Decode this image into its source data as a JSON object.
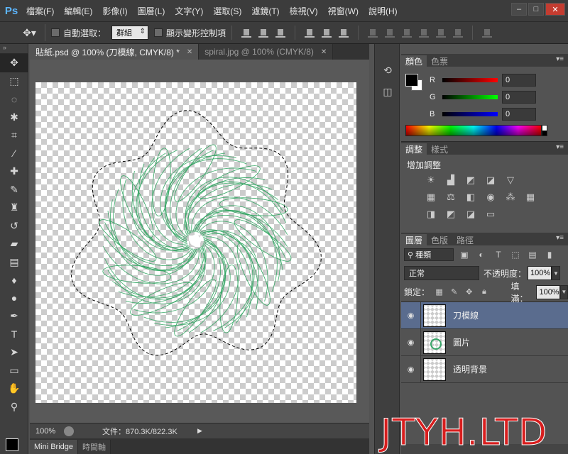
{
  "menu": {
    "logo": "Ps",
    "items": [
      "檔案(F)",
      "編輯(E)",
      "影像(I)",
      "圖層(L)",
      "文字(Y)",
      "選取(S)",
      "濾鏡(T)",
      "檢視(V)",
      "視窗(W)",
      "說明(H)"
    ],
    "window_controls": [
      "–",
      "□",
      "✕"
    ]
  },
  "options": {
    "auto_select_label": "自動選取：",
    "auto_select_value": "群組",
    "show_transform_label": "顯示變形控制項"
  },
  "documents": {
    "tabs": [
      {
        "title": "貼紙.psd @ 100% (刀模線, CMYK/8) *",
        "active": true
      },
      {
        "title": "spiral.jpg @ 100% (CMYK/8)",
        "active": false
      }
    ]
  },
  "status": {
    "zoom": "100%",
    "filesize": "文件：870.3K/822.3K"
  },
  "bottom_tabs": [
    "Mini Bridge",
    "時間軸"
  ],
  "color_panel": {
    "tabs": [
      "顏色",
      "色票"
    ],
    "channels": [
      {
        "label": "R",
        "value": "0",
        "gradient": "#ff0000"
      },
      {
        "label": "G",
        "value": "0",
        "gradient": "#00ff00"
      },
      {
        "label": "B",
        "value": "0",
        "gradient": "#0000ff"
      }
    ]
  },
  "adjustments_panel": {
    "tabs": [
      "調整",
      "樣式"
    ],
    "title": "增加調整"
  },
  "layers_panel": {
    "tabs": [
      "圖層",
      "色版",
      "路徑"
    ],
    "kind_filter": "種類",
    "blend_mode": "正常",
    "opacity_label": "不透明度：",
    "opacity_value": "100%",
    "lock_label": "鎖定：",
    "fill_label": "填滿：",
    "fill_value": "100%",
    "layers": [
      {
        "name": "刀模線",
        "selected": true,
        "thumb": "blank"
      },
      {
        "name": "圖片",
        "selected": false,
        "thumb": "spiral"
      },
      {
        "name": "透明背景",
        "selected": false,
        "thumb": "blank"
      }
    ]
  },
  "watermark": "JTYH.LTD",
  "colors": {
    "spiral_stroke": "#2fa560",
    "selected_layer": "#5a6c8e",
    "watermark": "#d81e1e"
  }
}
